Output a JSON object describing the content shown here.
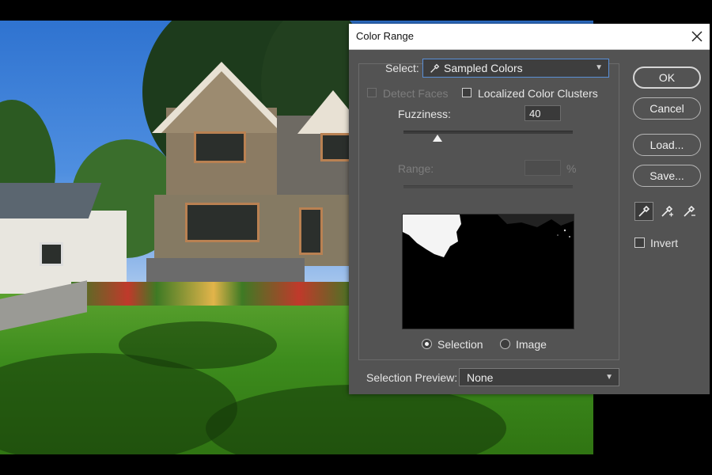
{
  "dialog": {
    "title": "Color Range",
    "select_label": "Select:",
    "select_value": "Sampled Colors",
    "detect_faces": "Detect Faces",
    "localized_clusters": "Localized Color Clusters",
    "fuzziness_label": "Fuzziness:",
    "fuzziness_value": "40",
    "fuzziness_level": 0.2,
    "range_label": "Range:",
    "range_unit": "%",
    "radio_selection": "Selection",
    "radio_image": "Image",
    "preview_label": "Selection Preview:",
    "preview_value": "None",
    "buttons": {
      "ok": "OK",
      "cancel": "Cancel",
      "load": "Load...",
      "save": "Save..."
    },
    "invert": "Invert"
  },
  "icons": [
    "close-icon",
    "eyedropper-icon",
    "eyedropper-plus-icon",
    "eyedropper-minus-icon",
    "chevron-down-icon"
  ],
  "colors": {
    "dialog_bg": "#535353",
    "field_bg": "#3e3e3e",
    "title_bg": "#ffffff"
  }
}
